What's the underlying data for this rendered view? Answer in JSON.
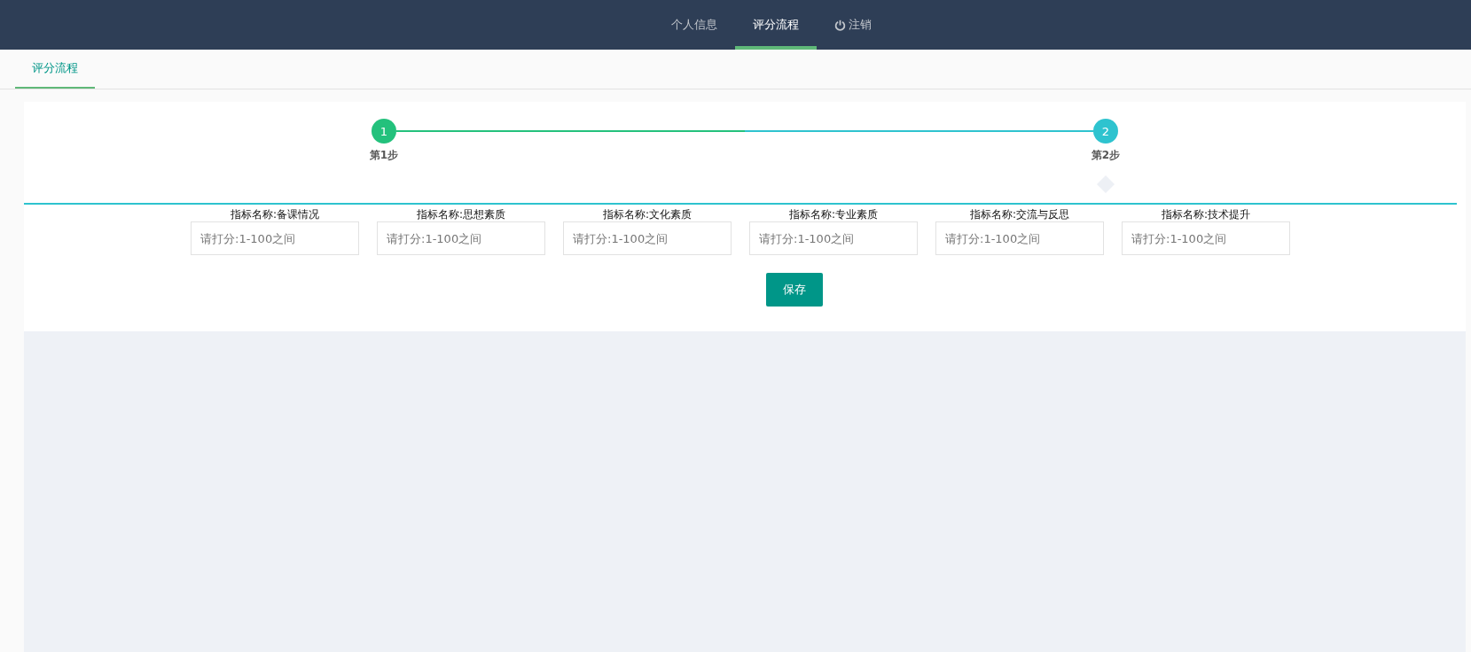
{
  "nav": {
    "items": [
      {
        "label": "个人信息",
        "kind": "link",
        "selected": false
      },
      {
        "label": "评分流程",
        "kind": "link",
        "selected": true
      },
      {
        "label": "注销",
        "kind": "logout",
        "selected": false
      }
    ]
  },
  "tabs": [
    {
      "label": "评分流程",
      "selected": true
    }
  ],
  "steps": [
    {
      "number": "1",
      "label": "第1步",
      "completed": true,
      "active": false
    },
    {
      "number": "2",
      "label": "第2步",
      "completed": false,
      "active": true
    }
  ],
  "fields": [
    {
      "label": "指标名称:备课情况",
      "placeholder": "请打分:1-100之间"
    },
    {
      "label": "指标名称:思想素质",
      "placeholder": "请打分:1-100之间"
    },
    {
      "label": "指标名称:文化素质",
      "placeholder": "请打分:1-100之间"
    },
    {
      "label": "指标名称:专业素质",
      "placeholder": "请打分:1-100之间"
    },
    {
      "label": "指标名称:交流与反思",
      "placeholder": "请打分:1-100之间"
    },
    {
      "label": "指标名称:技术提升",
      "placeholder": "请打分:1-100之间"
    }
  ],
  "save_button": "保存"
}
